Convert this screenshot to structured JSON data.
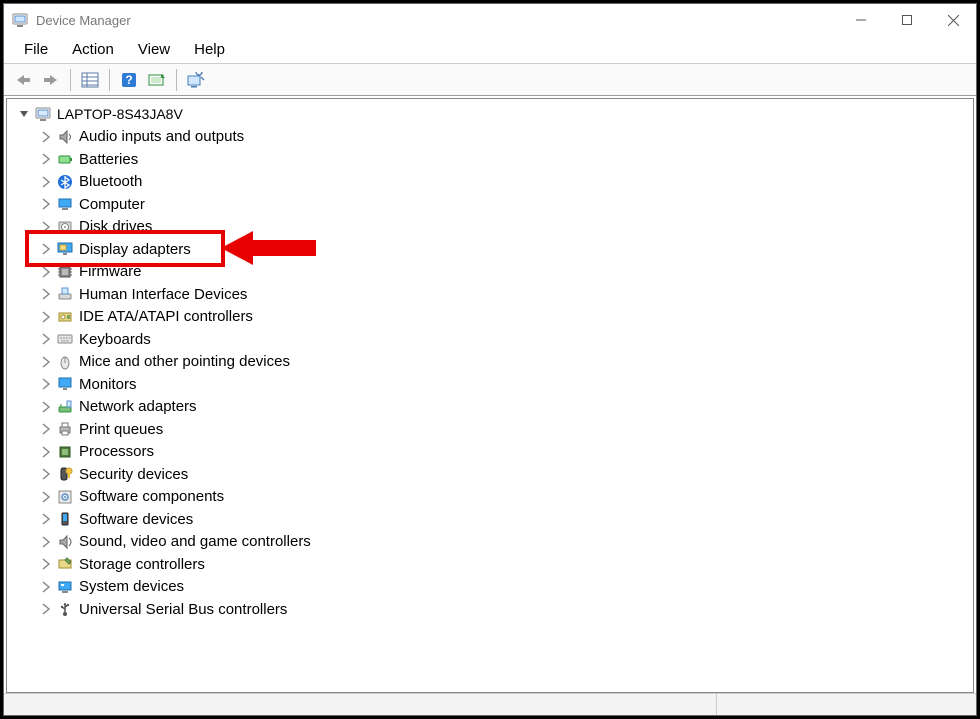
{
  "window": {
    "title": "Device Manager"
  },
  "menubar": [
    "File",
    "Action",
    "View",
    "Help"
  ],
  "tree": {
    "root": {
      "label": "LAPTOP-8S43JA8V",
      "expanded": true
    },
    "items": [
      {
        "label": "Audio inputs and outputs",
        "icon": "audio"
      },
      {
        "label": "Batteries",
        "icon": "battery"
      },
      {
        "label": "Bluetooth",
        "icon": "bluetooth"
      },
      {
        "label": "Computer",
        "icon": "computer"
      },
      {
        "label": "Disk drives",
        "icon": "disk"
      },
      {
        "label": "Display adapters",
        "icon": "display",
        "highlighted": true
      },
      {
        "label": "Firmware",
        "icon": "chip"
      },
      {
        "label": "Human Interface Devices",
        "icon": "hid"
      },
      {
        "label": "IDE ATA/ATAPI controllers",
        "icon": "ide"
      },
      {
        "label": "Keyboards",
        "icon": "keyboard"
      },
      {
        "label": "Mice and other pointing devices",
        "icon": "mouse"
      },
      {
        "label": "Monitors",
        "icon": "monitor"
      },
      {
        "label": "Network adapters",
        "icon": "network"
      },
      {
        "label": "Print queues",
        "icon": "printer"
      },
      {
        "label": "Processors",
        "icon": "cpu"
      },
      {
        "label": "Security devices",
        "icon": "security"
      },
      {
        "label": "Software components",
        "icon": "swcomp"
      },
      {
        "label": "Software devices",
        "icon": "swdev"
      },
      {
        "label": "Sound, video and game controllers",
        "icon": "sound"
      },
      {
        "label": "Storage controllers",
        "icon": "storage"
      },
      {
        "label": "System devices",
        "icon": "system"
      },
      {
        "label": "Universal Serial Bus controllers",
        "icon": "usb"
      }
    ]
  },
  "annotation": {
    "highlight_color": "#e60000",
    "arrow_color": "#e60000"
  }
}
